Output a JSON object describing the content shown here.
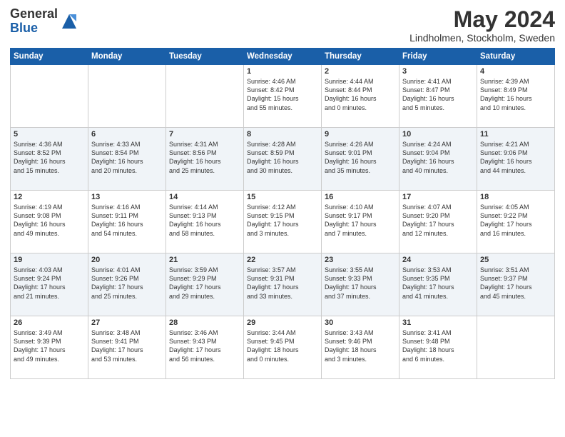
{
  "header": {
    "logo_general": "General",
    "logo_blue": "Blue",
    "month_title": "May 2024",
    "location": "Lindholmen, Stockholm, Sweden"
  },
  "days_of_week": [
    "Sunday",
    "Monday",
    "Tuesday",
    "Wednesday",
    "Thursday",
    "Friday",
    "Saturday"
  ],
  "weeks": [
    [
      {
        "day": "",
        "info": ""
      },
      {
        "day": "",
        "info": ""
      },
      {
        "day": "",
        "info": ""
      },
      {
        "day": "1",
        "info": "Sunrise: 4:46 AM\nSunset: 8:42 PM\nDaylight: 15 hours\nand 55 minutes."
      },
      {
        "day": "2",
        "info": "Sunrise: 4:44 AM\nSunset: 8:44 PM\nDaylight: 16 hours\nand 0 minutes."
      },
      {
        "day": "3",
        "info": "Sunrise: 4:41 AM\nSunset: 8:47 PM\nDaylight: 16 hours\nand 5 minutes."
      },
      {
        "day": "4",
        "info": "Sunrise: 4:39 AM\nSunset: 8:49 PM\nDaylight: 16 hours\nand 10 minutes."
      }
    ],
    [
      {
        "day": "5",
        "info": "Sunrise: 4:36 AM\nSunset: 8:52 PM\nDaylight: 16 hours\nand 15 minutes."
      },
      {
        "day": "6",
        "info": "Sunrise: 4:33 AM\nSunset: 8:54 PM\nDaylight: 16 hours\nand 20 minutes."
      },
      {
        "day": "7",
        "info": "Sunrise: 4:31 AM\nSunset: 8:56 PM\nDaylight: 16 hours\nand 25 minutes."
      },
      {
        "day": "8",
        "info": "Sunrise: 4:28 AM\nSunset: 8:59 PM\nDaylight: 16 hours\nand 30 minutes."
      },
      {
        "day": "9",
        "info": "Sunrise: 4:26 AM\nSunset: 9:01 PM\nDaylight: 16 hours\nand 35 minutes."
      },
      {
        "day": "10",
        "info": "Sunrise: 4:24 AM\nSunset: 9:04 PM\nDaylight: 16 hours\nand 40 minutes."
      },
      {
        "day": "11",
        "info": "Sunrise: 4:21 AM\nSunset: 9:06 PM\nDaylight: 16 hours\nand 44 minutes."
      }
    ],
    [
      {
        "day": "12",
        "info": "Sunrise: 4:19 AM\nSunset: 9:08 PM\nDaylight: 16 hours\nand 49 minutes."
      },
      {
        "day": "13",
        "info": "Sunrise: 4:16 AM\nSunset: 9:11 PM\nDaylight: 16 hours\nand 54 minutes."
      },
      {
        "day": "14",
        "info": "Sunrise: 4:14 AM\nSunset: 9:13 PM\nDaylight: 16 hours\nand 58 minutes."
      },
      {
        "day": "15",
        "info": "Sunrise: 4:12 AM\nSunset: 9:15 PM\nDaylight: 17 hours\nand 3 minutes."
      },
      {
        "day": "16",
        "info": "Sunrise: 4:10 AM\nSunset: 9:17 PM\nDaylight: 17 hours\nand 7 minutes."
      },
      {
        "day": "17",
        "info": "Sunrise: 4:07 AM\nSunset: 9:20 PM\nDaylight: 17 hours\nand 12 minutes."
      },
      {
        "day": "18",
        "info": "Sunrise: 4:05 AM\nSunset: 9:22 PM\nDaylight: 17 hours\nand 16 minutes."
      }
    ],
    [
      {
        "day": "19",
        "info": "Sunrise: 4:03 AM\nSunset: 9:24 PM\nDaylight: 17 hours\nand 21 minutes."
      },
      {
        "day": "20",
        "info": "Sunrise: 4:01 AM\nSunset: 9:26 PM\nDaylight: 17 hours\nand 25 minutes."
      },
      {
        "day": "21",
        "info": "Sunrise: 3:59 AM\nSunset: 9:29 PM\nDaylight: 17 hours\nand 29 minutes."
      },
      {
        "day": "22",
        "info": "Sunrise: 3:57 AM\nSunset: 9:31 PM\nDaylight: 17 hours\nand 33 minutes."
      },
      {
        "day": "23",
        "info": "Sunrise: 3:55 AM\nSunset: 9:33 PM\nDaylight: 17 hours\nand 37 minutes."
      },
      {
        "day": "24",
        "info": "Sunrise: 3:53 AM\nSunset: 9:35 PM\nDaylight: 17 hours\nand 41 minutes."
      },
      {
        "day": "25",
        "info": "Sunrise: 3:51 AM\nSunset: 9:37 PM\nDaylight: 17 hours\nand 45 minutes."
      }
    ],
    [
      {
        "day": "26",
        "info": "Sunrise: 3:49 AM\nSunset: 9:39 PM\nDaylight: 17 hours\nand 49 minutes."
      },
      {
        "day": "27",
        "info": "Sunrise: 3:48 AM\nSunset: 9:41 PM\nDaylight: 17 hours\nand 53 minutes."
      },
      {
        "day": "28",
        "info": "Sunrise: 3:46 AM\nSunset: 9:43 PM\nDaylight: 17 hours\nand 56 minutes."
      },
      {
        "day": "29",
        "info": "Sunrise: 3:44 AM\nSunset: 9:45 PM\nDaylight: 18 hours\nand 0 minutes."
      },
      {
        "day": "30",
        "info": "Sunrise: 3:43 AM\nSunset: 9:46 PM\nDaylight: 18 hours\nand 3 minutes."
      },
      {
        "day": "31",
        "info": "Sunrise: 3:41 AM\nSunset: 9:48 PM\nDaylight: 18 hours\nand 6 minutes."
      },
      {
        "day": "",
        "info": ""
      }
    ]
  ]
}
